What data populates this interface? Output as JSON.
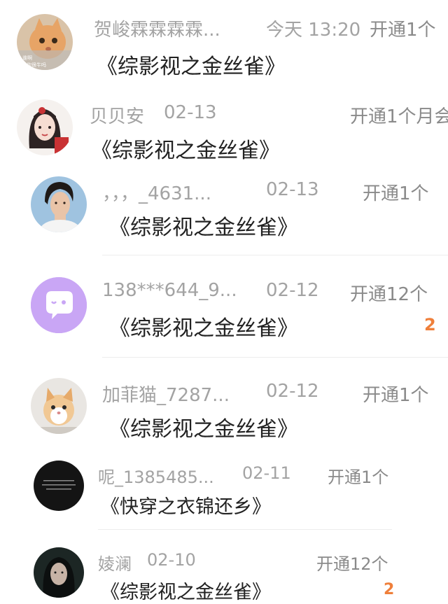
{
  "items": [
    {
      "name": "贺峻霖霖霖霖...",
      "date": "今天 13:20",
      "action": "开通1个",
      "title": "《综影视之金丝雀》",
      "avatar_icon": "cat-photo-avatar",
      "avatar_text": [
        "谁啊",
        "? 你很牛吗"
      ]
    },
    {
      "name": "贝贝安",
      "date": "02-13",
      "action": "开通1个月会",
      "title": "《综影视之金丝雀》",
      "avatar_icon": "drawn-girl-avatar"
    },
    {
      "name": "，，，_4631...",
      "date": "02-13",
      "action": "开通1个",
      "title": "《综影视之金丝雀》",
      "avatar_icon": "man-portrait-avatar"
    },
    {
      "name": "138***644_9...",
      "date": "02-12",
      "action": "开通12个",
      "title": "《综影视之金丝雀》",
      "count": "2",
      "avatar_icon": "chat-bubble-avatar"
    },
    {
      "name": "加菲猫_7287...",
      "date": "02-12",
      "action": "开通1个",
      "title": "《综影视之金丝雀》",
      "avatar_icon": "kitten-photo-avatar"
    },
    {
      "name": "呢_1385485...",
      "date": "02-11",
      "action": "开通1个",
      "title": "《快穿之衣锦还乡》",
      "avatar_icon": "dark-text-avatar"
    },
    {
      "name": "婈澜",
      "date": "02-10",
      "action": "开通12个",
      "title": "《综影视之金丝雀》",
      "count": "2",
      "avatar_icon": "dark-girl-avatar"
    }
  ],
  "colors": {
    "meta_text": "#a3a3a3",
    "title_text": "#222222",
    "count_accent": "#ef7f3a",
    "chat_avatar_bg": "#c9a6f5"
  }
}
